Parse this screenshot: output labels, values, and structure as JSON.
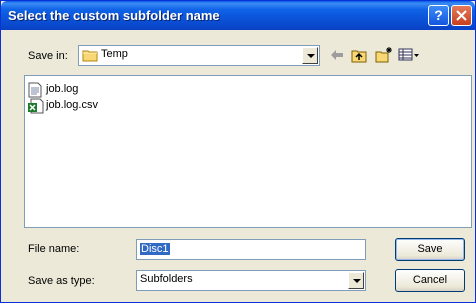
{
  "window": {
    "title": "Select the custom subfolder name",
    "help_label": "?"
  },
  "save_in": {
    "label": "Save in:",
    "value": "Temp"
  },
  "files": [
    {
      "name": "job.log",
      "icon": "text-file-icon"
    },
    {
      "name": "job.log.csv",
      "icon": "excel-file-icon"
    }
  ],
  "file_name": {
    "label": "File name:",
    "value": "Disc1"
  },
  "save_as_type": {
    "label": "Save as type:",
    "value": "Subfolders"
  },
  "buttons": {
    "save": "Save",
    "cancel": "Cancel"
  }
}
